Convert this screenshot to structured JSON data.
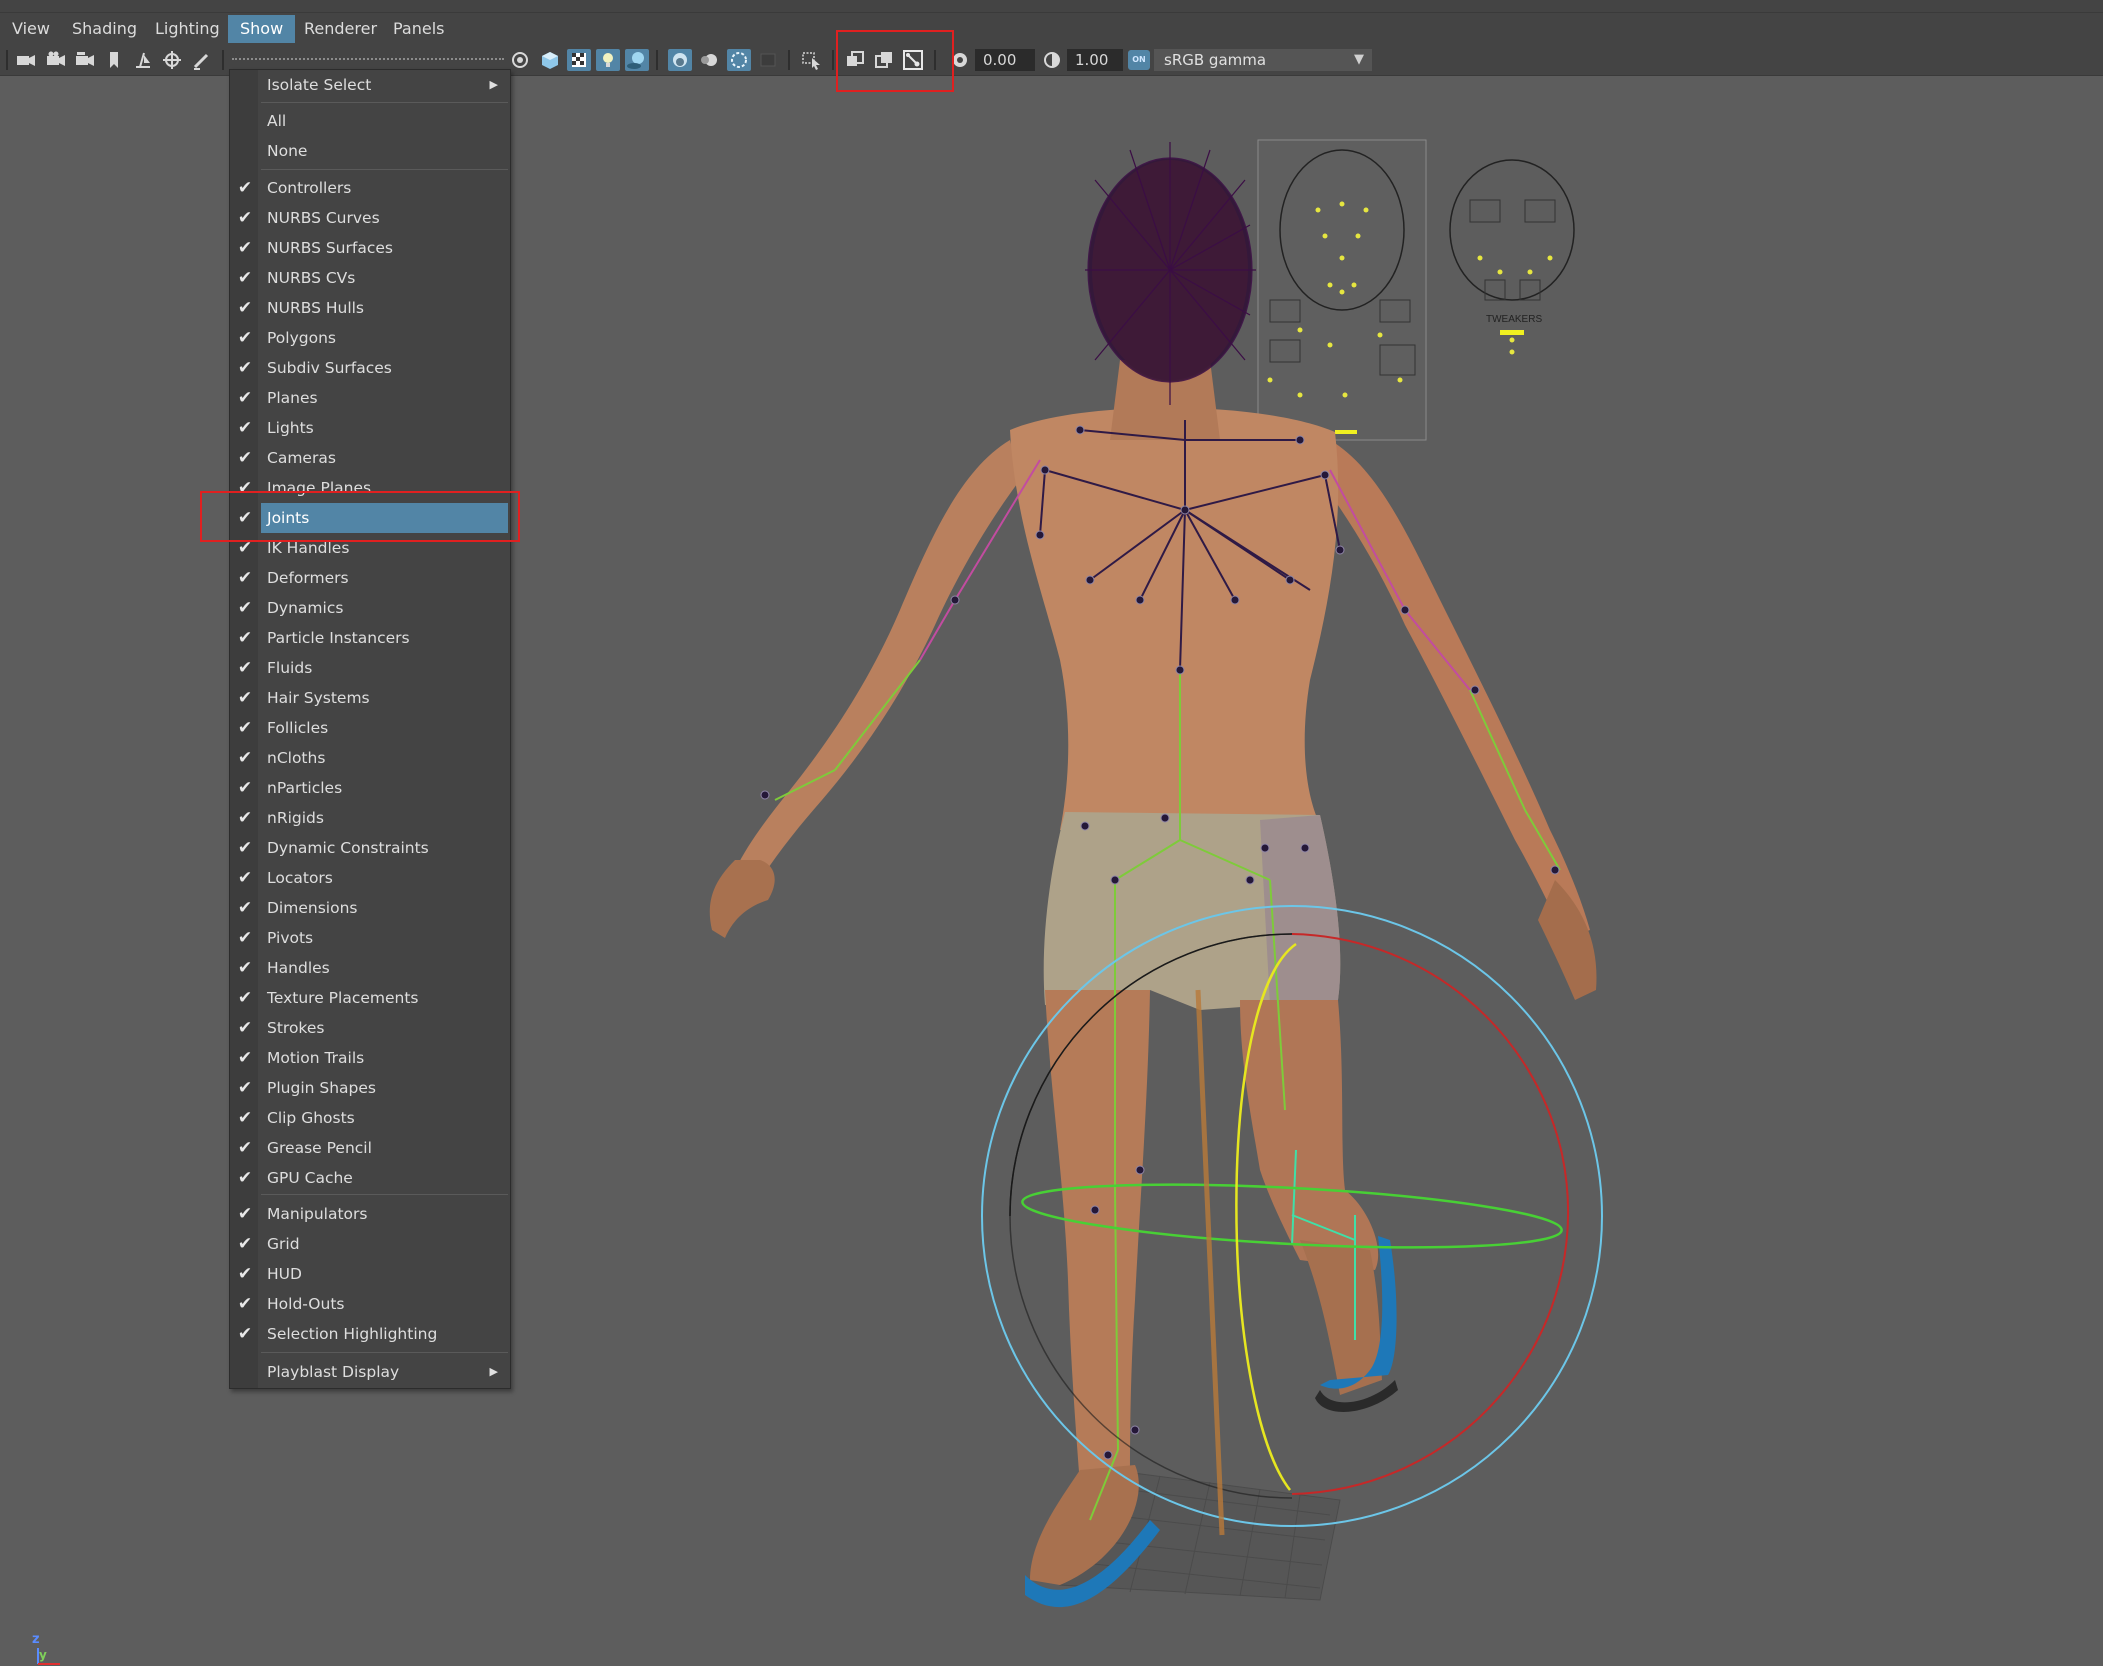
{
  "menubar": {
    "items": [
      {
        "label": "View"
      },
      {
        "label": "Shading"
      },
      {
        "label": "Lighting"
      },
      {
        "label": "Show"
      },
      {
        "label": "Renderer"
      },
      {
        "label": "Panels"
      }
    ],
    "active": "Show"
  },
  "toolbar": {
    "exposure_value": "0.00",
    "gamma_value": "1.00",
    "color_management_badge": "ON",
    "color_space": "sRGB gamma",
    "highlight_color": "#5285a6",
    "annotation_color": "#e02020"
  },
  "show_menu": {
    "isolate_select": "Isolate Select",
    "all": "All",
    "none": "None",
    "items": [
      {
        "label": "Controllers",
        "checked": true
      },
      {
        "label": "NURBS Curves",
        "checked": true
      },
      {
        "label": "NURBS Surfaces",
        "checked": true
      },
      {
        "label": "NURBS CVs",
        "checked": true
      },
      {
        "label": "NURBS Hulls",
        "checked": true
      },
      {
        "label": "Polygons",
        "checked": true
      },
      {
        "label": "Subdiv Surfaces",
        "checked": true
      },
      {
        "label": "Planes",
        "checked": true
      },
      {
        "label": "Lights",
        "checked": true
      },
      {
        "label": "Cameras",
        "checked": true
      },
      {
        "label": "Image Planes",
        "checked": true
      },
      {
        "label": "Joints",
        "checked": true
      },
      {
        "label": "IK Handles",
        "checked": true
      },
      {
        "label": "Deformers",
        "checked": true
      },
      {
        "label": "Dynamics",
        "checked": true
      },
      {
        "label": "Particle Instancers",
        "checked": true
      },
      {
        "label": "Fluids",
        "checked": true
      },
      {
        "label": "Hair Systems",
        "checked": true
      },
      {
        "label": "Follicles",
        "checked": true
      },
      {
        "label": "nCloths",
        "checked": true
      },
      {
        "label": "nParticles",
        "checked": true
      },
      {
        "label": "nRigids",
        "checked": true
      },
      {
        "label": "Dynamic Constraints",
        "checked": true
      },
      {
        "label": "Locators",
        "checked": true
      },
      {
        "label": "Dimensions",
        "checked": true
      },
      {
        "label": "Pivots",
        "checked": true
      },
      {
        "label": "Handles",
        "checked": true
      },
      {
        "label": "Texture Placements",
        "checked": true
      },
      {
        "label": "Strokes",
        "checked": true
      },
      {
        "label": "Motion Trails",
        "checked": true
      },
      {
        "label": "Plugin Shapes",
        "checked": true
      },
      {
        "label": "Clip Ghosts",
        "checked": true
      },
      {
        "label": "Grease Pencil",
        "checked": true
      },
      {
        "label": "GPU Cache",
        "checked": true
      }
    ],
    "display_items": [
      {
        "label": "Manipulators",
        "checked": true
      },
      {
        "label": "Grid",
        "checked": true
      },
      {
        "label": "HUD",
        "checked": true
      },
      {
        "label": "Hold-Outs",
        "checked": true
      },
      {
        "label": "Selection Highlighting",
        "checked": true
      }
    ],
    "playblast": "Playblast Display",
    "highlighted_item": "Joints"
  },
  "viewport": {
    "face_picker_label": "TWEAKERS",
    "axis_z": "z",
    "axis_y": "y"
  }
}
